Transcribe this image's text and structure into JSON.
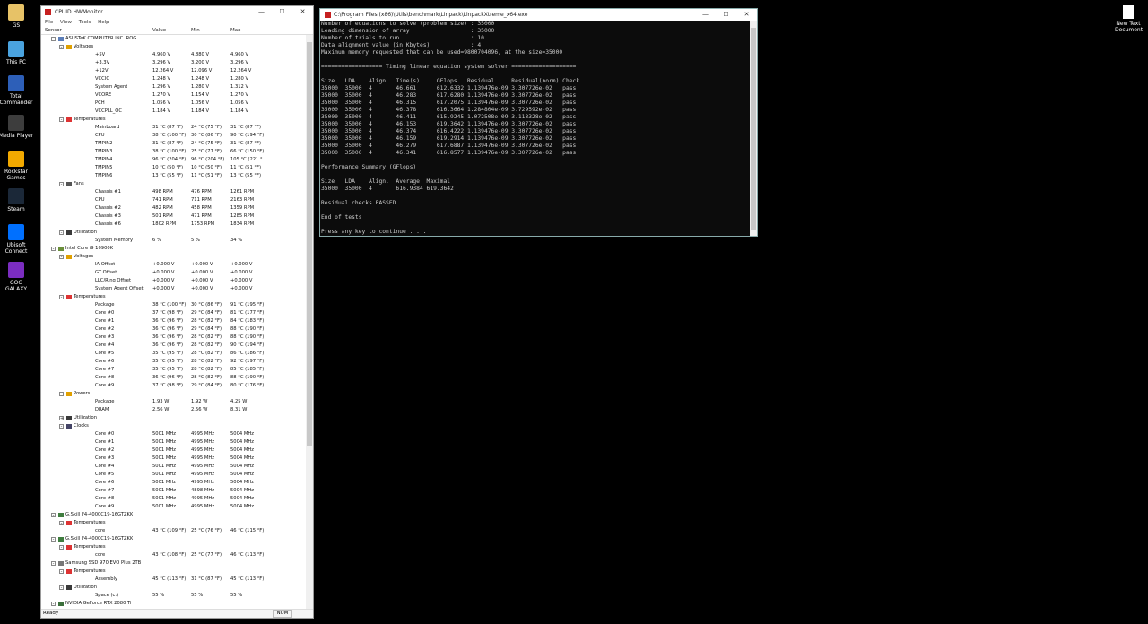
{
  "desktop": {
    "icons": [
      {
        "label": "GS",
        "color": "#e7c267"
      },
      {
        "label": "This PC",
        "color": "#4aa3df"
      },
      {
        "label": "Total Commander",
        "color": "#2d5fb8"
      },
      {
        "label": "Media Player",
        "color": "#3d3d3d"
      },
      {
        "label": "Rockstar Games",
        "color": "#f2a900"
      },
      {
        "label": "Steam",
        "color": "#1b2838"
      },
      {
        "label": "Ubisoft Connect",
        "color": "#0070ff"
      },
      {
        "label": "GOG GALAXY",
        "color": "#7b2dc0"
      }
    ],
    "right_icon": {
      "label": "New Text Document"
    }
  },
  "hwmonitor": {
    "title": "CPUID HWMonitor",
    "menu": [
      "File",
      "View",
      "Tools",
      "Help"
    ],
    "columns": [
      "Sensor",
      "Value",
      "Min",
      "Max"
    ],
    "status": "Ready",
    "num_indicator": "NUM",
    "rows": [
      {
        "l": 0,
        "t": "hw",
        "n": "ASUSTeK COMPUTER INC. ROG...",
        "v": "",
        "mn": "",
        "mx": ""
      },
      {
        "l": 1,
        "t": "volt",
        "n": "Voltages",
        "v": "",
        "mn": "",
        "mx": ""
      },
      {
        "l": 2,
        "t": "",
        "n": "+5V",
        "v": "4.960 V",
        "mn": "4.880 V",
        "mx": "4.960 V"
      },
      {
        "l": 2,
        "t": "",
        "n": "+3.3V",
        "v": "3.296 V",
        "mn": "3.200 V",
        "mx": "3.296 V"
      },
      {
        "l": 2,
        "t": "",
        "n": "+12V",
        "v": "12.264 V",
        "mn": "12.096 V",
        "mx": "12.264 V"
      },
      {
        "l": 2,
        "t": "",
        "n": "VCCIO",
        "v": "1.248 V",
        "mn": "1.248 V",
        "mx": "1.280 V"
      },
      {
        "l": 2,
        "t": "",
        "n": "System Agent",
        "v": "1.296 V",
        "mn": "1.280 V",
        "mx": "1.312 V"
      },
      {
        "l": 2,
        "t": "",
        "n": "VCORE",
        "v": "1.270 V",
        "mn": "1.154 V",
        "mx": "1.270 V"
      },
      {
        "l": 2,
        "t": "",
        "n": "PCH",
        "v": "1.056 V",
        "mn": "1.056 V",
        "mx": "1.056 V"
      },
      {
        "l": 2,
        "t": "",
        "n": "VCCPLL_OC",
        "v": "1.184 V",
        "mn": "1.184 V",
        "mx": "1.184 V"
      },
      {
        "l": 1,
        "t": "temp",
        "n": "Temperatures",
        "v": "",
        "mn": "",
        "mx": ""
      },
      {
        "l": 2,
        "t": "",
        "n": "Mainboard",
        "v": "31 °C  (87 °F)",
        "mn": "24 °C  (75 °F)",
        "mx": "31 °C  (87 °F)"
      },
      {
        "l": 2,
        "t": "",
        "n": "CPU",
        "v": "38 °C  (100 °F)",
        "mn": "30 °C  (86 °F)",
        "mx": "90 °C  (194 °F)"
      },
      {
        "l": 2,
        "t": "",
        "n": "TMPIN2",
        "v": "31 °C  (87 °F)",
        "mn": "24 °C  (75 °F)",
        "mx": "31 °C  (87 °F)"
      },
      {
        "l": 2,
        "t": "",
        "n": "TMPIN3",
        "v": "38 °C  (100 °F)",
        "mn": "25 °C  (77 °F)",
        "mx": "66 °C  (150 °F)"
      },
      {
        "l": 2,
        "t": "",
        "n": "TMPIN4",
        "v": "96 °C  (204 °F)",
        "mn": "96 °C  (204 °F)",
        "mx": "105 °C  (221 °..."
      },
      {
        "l": 2,
        "t": "",
        "n": "TMPIN5",
        "v": "10 °C  (50 °F)",
        "mn": "10 °C  (50 °F)",
        "mx": "11 °C  (51 °F)"
      },
      {
        "l": 2,
        "t": "",
        "n": "TMPIN6",
        "v": "13 °C  (55 °F)",
        "mn": "11 °C  (51 °F)",
        "mx": "13 °C  (55 °F)"
      },
      {
        "l": 1,
        "t": "fan",
        "n": "Fans",
        "v": "",
        "mn": "",
        "mx": ""
      },
      {
        "l": 2,
        "t": "",
        "n": "Chassis #1",
        "v": "498 RPM",
        "mn": "476 RPM",
        "mx": "1261 RPM"
      },
      {
        "l": 2,
        "t": "",
        "n": "CPU",
        "v": "741 RPM",
        "mn": "711 RPM",
        "mx": "2163 RPM"
      },
      {
        "l": 2,
        "t": "",
        "n": "Chassis #2",
        "v": "482 RPM",
        "mn": "458 RPM",
        "mx": "1359 RPM"
      },
      {
        "l": 2,
        "t": "",
        "n": "Chassis #3",
        "v": "501 RPM",
        "mn": "471 RPM",
        "mx": "1285 RPM"
      },
      {
        "l": 2,
        "t": "",
        "n": "Chassis #6",
        "v": "1802 RPM",
        "mn": "1753 RPM",
        "mx": "1834 RPM"
      },
      {
        "l": 1,
        "t": "util",
        "n": "Utilization",
        "v": "",
        "mn": "",
        "mx": ""
      },
      {
        "l": 2,
        "t": "",
        "n": "System Memory",
        "v": "6 %",
        "mn": "5 %",
        "mx": "34 %"
      },
      {
        "l": 0,
        "t": "cpu",
        "n": "Intel Core i9 10900K",
        "v": "",
        "mn": "",
        "mx": ""
      },
      {
        "l": 1,
        "t": "volt",
        "n": "Voltages",
        "v": "",
        "mn": "",
        "mx": ""
      },
      {
        "l": 2,
        "t": "",
        "n": "IA Offset",
        "v": "+0.000 V",
        "mn": "+0.000 V",
        "mx": "+0.000 V"
      },
      {
        "l": 2,
        "t": "",
        "n": "GT Offset",
        "v": "+0.000 V",
        "mn": "+0.000 V",
        "mx": "+0.000 V"
      },
      {
        "l": 2,
        "t": "",
        "n": "LLC/Ring Offset",
        "v": "+0.000 V",
        "mn": "+0.000 V",
        "mx": "+0.000 V"
      },
      {
        "l": 2,
        "t": "",
        "n": "System Agent Offset",
        "v": "+0.000 V",
        "mn": "+0.000 V",
        "mx": "+0.000 V"
      },
      {
        "l": 1,
        "t": "temp",
        "n": "Temperatures",
        "v": "",
        "mn": "",
        "mx": ""
      },
      {
        "l": 2,
        "t": "",
        "n": "Package",
        "v": "38 °C  (100 °F)",
        "mn": "30 °C  (86 °F)",
        "mx": "91 °C  (195 °F)"
      },
      {
        "l": 2,
        "t": "",
        "n": "Core #0",
        "v": "37 °C  (98 °F)",
        "mn": "29 °C  (84 °F)",
        "mx": "81 °C  (177 °F)"
      },
      {
        "l": 2,
        "t": "",
        "n": "Core #1",
        "v": "36 °C  (96 °F)",
        "mn": "28 °C  (82 °F)",
        "mx": "84 °C  (183 °F)"
      },
      {
        "l": 2,
        "t": "",
        "n": "Core #2",
        "v": "36 °C  (96 °F)",
        "mn": "29 °C  (84 °F)",
        "mx": "88 °C  (190 °F)"
      },
      {
        "l": 2,
        "t": "",
        "n": "Core #3",
        "v": "36 °C  (96 °F)",
        "mn": "28 °C  (82 °F)",
        "mx": "88 °C  (190 °F)"
      },
      {
        "l": 2,
        "t": "",
        "n": "Core #4",
        "v": "36 °C  (96 °F)",
        "mn": "28 °C  (82 °F)",
        "mx": "90 °C  (194 °F)"
      },
      {
        "l": 2,
        "t": "",
        "n": "Core #5",
        "v": "35 °C  (95 °F)",
        "mn": "28 °C  (82 °F)",
        "mx": "86 °C  (186 °F)"
      },
      {
        "l": 2,
        "t": "",
        "n": "Core #6",
        "v": "35 °C  (95 °F)",
        "mn": "28 °C  (82 °F)",
        "mx": "92 °C  (197 °F)"
      },
      {
        "l": 2,
        "t": "",
        "n": "Core #7",
        "v": "35 °C  (95 °F)",
        "mn": "28 °C  (82 °F)",
        "mx": "85 °C  (185 °F)"
      },
      {
        "l": 2,
        "t": "",
        "n": "Core #8",
        "v": "36 °C  (96 °F)",
        "mn": "28 °C  (82 °F)",
        "mx": "88 °C  (190 °F)"
      },
      {
        "l": 2,
        "t": "",
        "n": "Core #9",
        "v": "37 °C  (98 °F)",
        "mn": "29 °C  (84 °F)",
        "mx": "80 °C  (176 °F)"
      },
      {
        "l": 1,
        "t": "pow",
        "n": "Powers",
        "v": "",
        "mn": "",
        "mx": ""
      },
      {
        "l": 2,
        "t": "",
        "n": "Package",
        "v": "1.93 W",
        "mn": "1.92 W",
        "mx": "4.25 W"
      },
      {
        "l": 2,
        "t": "",
        "n": "DRAM",
        "v": "2.56 W",
        "mn": "2.56 W",
        "mx": "8.31 W"
      },
      {
        "l": 1,
        "t": "util",
        "n": "Utilization",
        "v": "",
        "mn": "",
        "mx": "",
        "collapsed": true
      },
      {
        "l": 1,
        "t": "clk",
        "n": "Clocks",
        "v": "",
        "mn": "",
        "mx": ""
      },
      {
        "l": 2,
        "t": "",
        "n": "Core #0",
        "v": "5001 MHz",
        "mn": "4995 MHz",
        "mx": "5004 MHz"
      },
      {
        "l": 2,
        "t": "",
        "n": "Core #1",
        "v": "5001 MHz",
        "mn": "4995 MHz",
        "mx": "5004 MHz"
      },
      {
        "l": 2,
        "t": "",
        "n": "Core #2",
        "v": "5001 MHz",
        "mn": "4995 MHz",
        "mx": "5004 MHz"
      },
      {
        "l": 2,
        "t": "",
        "n": "Core #3",
        "v": "5001 MHz",
        "mn": "4995 MHz",
        "mx": "5004 MHz"
      },
      {
        "l": 2,
        "t": "",
        "n": "Core #4",
        "v": "5001 MHz",
        "mn": "4995 MHz",
        "mx": "5004 MHz"
      },
      {
        "l": 2,
        "t": "",
        "n": "Core #5",
        "v": "5001 MHz",
        "mn": "4995 MHz",
        "mx": "5004 MHz"
      },
      {
        "l": 2,
        "t": "",
        "n": "Core #6",
        "v": "5001 MHz",
        "mn": "4995 MHz",
        "mx": "5004 MHz"
      },
      {
        "l": 2,
        "t": "",
        "n": "Core #7",
        "v": "5001 MHz",
        "mn": "4898 MHz",
        "mx": "5004 MHz"
      },
      {
        "l": 2,
        "t": "",
        "n": "Core #8",
        "v": "5001 MHz",
        "mn": "4995 MHz",
        "mx": "5004 MHz"
      },
      {
        "l": 2,
        "t": "",
        "n": "Core #9",
        "v": "5001 MHz",
        "mn": "4995 MHz",
        "mx": "5004 MHz"
      },
      {
        "l": 0,
        "t": "ram",
        "n": "G.Skill F4-4000C19-16GTZKK",
        "v": "",
        "mn": "",
        "mx": ""
      },
      {
        "l": 1,
        "t": "temp",
        "n": "Temperatures",
        "v": "",
        "mn": "",
        "mx": ""
      },
      {
        "l": 2,
        "t": "",
        "n": "core",
        "v": "43 °C  (109 °F)",
        "mn": "25 °C  (76 °F)",
        "mx": "46 °C  (115 °F)"
      },
      {
        "l": 0,
        "t": "ram",
        "n": "G.Skill F4-4000C19-16GTZKK",
        "v": "",
        "mn": "",
        "mx": ""
      },
      {
        "l": 1,
        "t": "temp",
        "n": "Temperatures",
        "v": "",
        "mn": "",
        "mx": ""
      },
      {
        "l": 2,
        "t": "",
        "n": "core",
        "v": "43 °C  (108 °F)",
        "mn": "25 °C  (77 °F)",
        "mx": "46 °C  (113 °F)"
      },
      {
        "l": 0,
        "t": "ssd",
        "n": "Samsung SSD 970 EVO Plus 2TB",
        "v": "",
        "mn": "",
        "mx": ""
      },
      {
        "l": 1,
        "t": "temp",
        "n": "Temperatures",
        "v": "",
        "mn": "",
        "mx": ""
      },
      {
        "l": 2,
        "t": "",
        "n": "Assembly",
        "v": "45 °C  (113 °F)",
        "mn": "31 °C  (87 °F)",
        "mx": "45 °C  (113 °F)"
      },
      {
        "l": 1,
        "t": "util",
        "n": "Utilization",
        "v": "",
        "mn": "",
        "mx": ""
      },
      {
        "l": 2,
        "t": "",
        "n": "Space (c:)",
        "v": "55 %",
        "mn": "55 %",
        "mx": "55 %"
      },
      {
        "l": 0,
        "t": "gpu",
        "n": "NVIDIA GeForce RTX 2080 Ti",
        "v": "",
        "mn": "",
        "mx": ""
      }
    ]
  },
  "console": {
    "title": "C:\\Program Files (x86)\\Utils\\benchmark\\Linpack\\LinpackXtreme_x64.exe",
    "lines": [
      "Number of equations to solve (problem size) : 35000",
      "Leading dimension of array                  : 35000",
      "Number of trials to run                     : 10",
      "Data alignment value (in Kbytes)            : 4",
      "Maximum memory requested that can be used=9800704096, at the size=35000",
      "",
      "================== Timing linear equation system solver ===================",
      "",
      "Size   LDA    Align.  Time(s)     GFlops   Residual     Residual(norm) Check",
      "35000  35000  4       46.661      612.6332 1.139476e-09 3.307726e-02   pass",
      "35000  35000  4       46.283      617.6280 1.139476e-09 3.307726e-02   pass",
      "35000  35000  4       46.315      617.2075 1.139476e-09 3.307726e-02   pass",
      "35000  35000  4       46.378      616.3664 1.284804e-09 3.729592e-02   pass",
      "35000  35000  4       46.411      615.9245 1.072508e-09 3.113328e-02   pass",
      "35000  35000  4       46.153      619.3642 1.139476e-09 3.307726e-02   pass",
      "35000  35000  4       46.374      616.4222 1.139476e-09 3.307726e-02   pass",
      "35000  35000  4       46.159      619.2914 1.139476e-09 3.307726e-02   pass",
      "35000  35000  4       46.279      617.6887 1.139476e-09 3.307726e-02   pass",
      "35000  35000  4       46.341      616.8577 1.139476e-09 3.307726e-02   pass",
      "",
      "Performance Summary (GFlops)",
      "",
      "Size   LDA    Align.  Average  Maximal",
      "35000  35000  4       616.9384 619.3642",
      "",
      "Residual checks PASSED",
      "",
      "End of tests",
      "",
      "Press any key to continue . . ."
    ]
  }
}
